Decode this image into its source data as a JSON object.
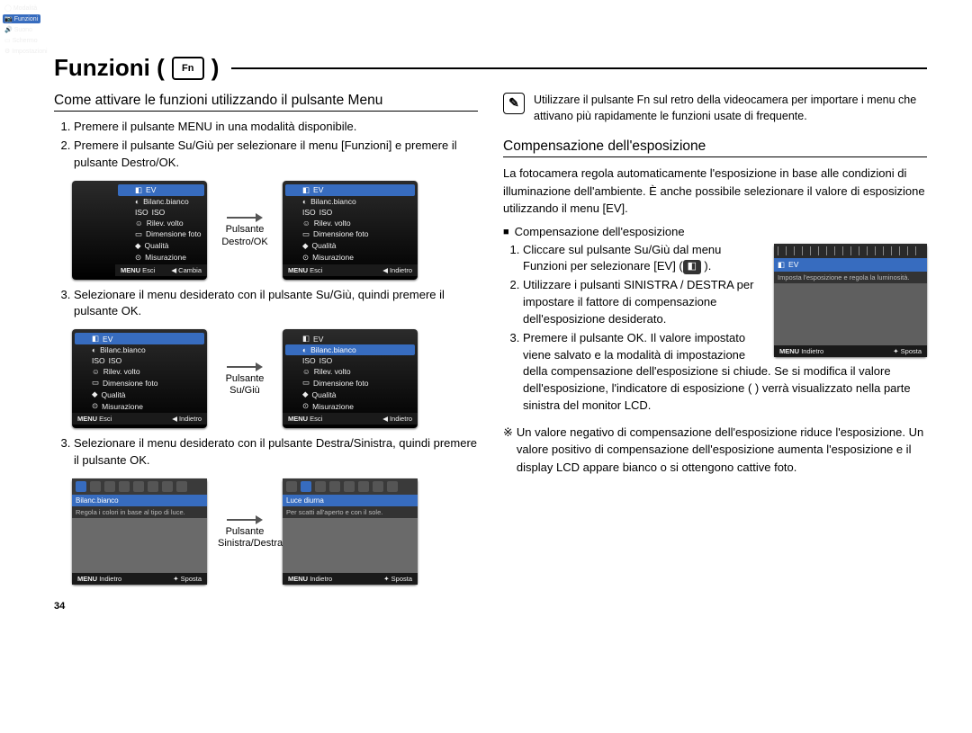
{
  "title": "Funzioni (",
  "title_icon_label": "Fn",
  "title_close": " )",
  "page_number": "34",
  "left": {
    "subhead": "Come attivare le funzioni utilizzando il pulsante Menu",
    "steps_a": [
      "Premere il pulsante MENU in una modalità disponibile.",
      "Premere il pulsante Su/Giù per selezionare il menu [Funzioni] e premere il pulsante Destro/OK."
    ],
    "caption1": "Pulsante Destro/OK",
    "step3a": "Selezionare il menu desiderato con il pulsante Su/Giù, quindi premere il pulsante OK.",
    "caption2": "Pulsante Su/Giù",
    "step3b": "Selezionare il menu desiderato con il pulsante Destra/Sinistra, quindi premere il pulsante OK.",
    "caption3": "Pulsante Sinistra/Destra"
  },
  "menu": {
    "side": [
      {
        "label": "Modalità"
      },
      {
        "label": "Funzioni",
        "sel": true
      },
      {
        "label": "Suono"
      },
      {
        "label": "Schermo"
      },
      {
        "label": "Impostazioni"
      }
    ],
    "items": [
      "EV",
      "Bilanc.bianco",
      "ISO",
      "Rilev. volto",
      "Dimensione foto",
      "Qualità",
      "Misurazione"
    ],
    "hl_ev": 0,
    "hl_wb": 1,
    "foot_esc": "Esci",
    "foot_change": "Cambia",
    "foot_back": "Indietro",
    "menu_label": "MENU"
  },
  "wb": {
    "label1": "Bilanc.bianco",
    "desc1": "Regola i colori in base al tipo di luce.",
    "label2": "Luce diurna",
    "desc2": "Per scatti all'aperto e con il sole.",
    "foot_back": "Indietro",
    "foot_move": "Sposta",
    "menu_label": "MENU"
  },
  "right": {
    "note": "Utilizzare il pulsante Fn sul retro della videocamera per importare i menu che attivano più rapidamente le funzioni usate di frequente.",
    "subhead": "Compensazione dell'esposizione",
    "intro": "La fotocamera regola automaticamente l'esposizione in base alle condizioni di illuminazione dell'ambiente. È anche possibile selezionare il valore di esposizione utilizzando il menu [EV].",
    "bullet": "Compensazione dell'esposizione",
    "steps": [
      "Cliccare sul pulsante Su/Giù dal menu Funzioni per selezionare [EV] (",
      "Utilizzare i pulsanti SINISTRA / DESTRA per impostare il fattore di compensazione dell'esposizione desiderato.",
      "Premere il pulsante OK. Il valore impostato viene salvato e la modalità di impostazione della compensazione dell'esposizione si chiude. Se si modifica il valore dell'esposizione, l'indicatore di esposizione (        ) verrà visualizzato nella parte sinistra del monitor LCD."
    ],
    "step1_tail": " ).",
    "starnote": "Un valore negativo di compensazione dell'esposizione riduce l'esposizione. Un valore positivo di compensazione dell'esposizione aumenta l'esposizione e il display LCD appare bianco o si ottengono cattive foto.",
    "ev": {
      "title": "EV",
      "desc": "Imposta l'esposizione e regola la luminosità.",
      "foot_back": "Indietro",
      "foot_move": "Sposta",
      "menu_label": "MENU"
    }
  }
}
